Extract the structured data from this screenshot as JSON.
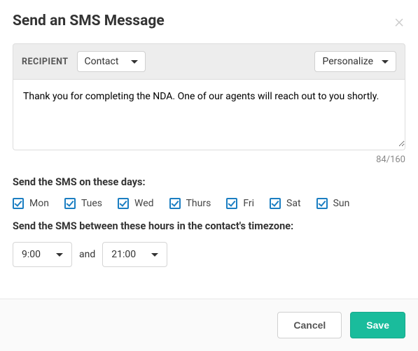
{
  "header": {
    "title": "Send an SMS Message"
  },
  "recipient": {
    "label": "RECIPIENT",
    "value": "Contact"
  },
  "personalize": {
    "label": "Personalize"
  },
  "message": {
    "text": "Thank you for completing the NDA. One of our agents will reach out to you shortly.",
    "char_count": "84/160"
  },
  "days": {
    "label": "Send the SMS on these days:",
    "items": [
      {
        "label": "Mon",
        "checked": true
      },
      {
        "label": "Tues",
        "checked": true
      },
      {
        "label": "Wed",
        "checked": true
      },
      {
        "label": "Thurs",
        "checked": true
      },
      {
        "label": "Fri",
        "checked": true
      },
      {
        "label": "Sat",
        "checked": true
      },
      {
        "label": "Sun",
        "checked": true
      }
    ]
  },
  "hours": {
    "label": "Send the SMS between these hours in the contact's timezone:",
    "from": "9:00",
    "connector": "and",
    "to": "21:00"
  },
  "footer": {
    "cancel": "Cancel",
    "save": "Save"
  }
}
